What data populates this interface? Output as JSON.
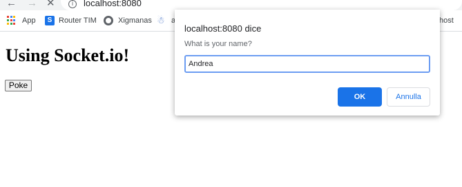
{
  "toolbar": {
    "back_icon": "←",
    "forward_icon": "→",
    "stop_icon": "✕",
    "info_icon": "i",
    "url": "localhost:8080"
  },
  "bookmarks": [
    {
      "label": "App",
      "icon": "apps-grid-icon"
    },
    {
      "label": "Router TIM",
      "icon": "router-icon",
      "icon_text": "S"
    },
    {
      "label": "Xigmanas",
      "icon": "xigmanas-icon"
    },
    {
      "label": "a",
      "icon": "network-icon"
    },
    {
      "label": "host"
    }
  ],
  "colors": {
    "apps_grid": [
      "#ea4335",
      "#4285f4",
      "#fbbc05",
      "#34a853",
      "#ea4335",
      "#4285f4",
      "#fbbc05",
      "#34a853",
      "#ea4335"
    ],
    "accent": "#1a73e8"
  },
  "page": {
    "title": "Using Socket.io!",
    "poke_label": "Poke"
  },
  "dialog": {
    "title": "localhost:8080 dice",
    "prompt": "What is your name?",
    "input_value": "Andrea",
    "ok_label": "OK",
    "cancel_label": "Annulla"
  }
}
